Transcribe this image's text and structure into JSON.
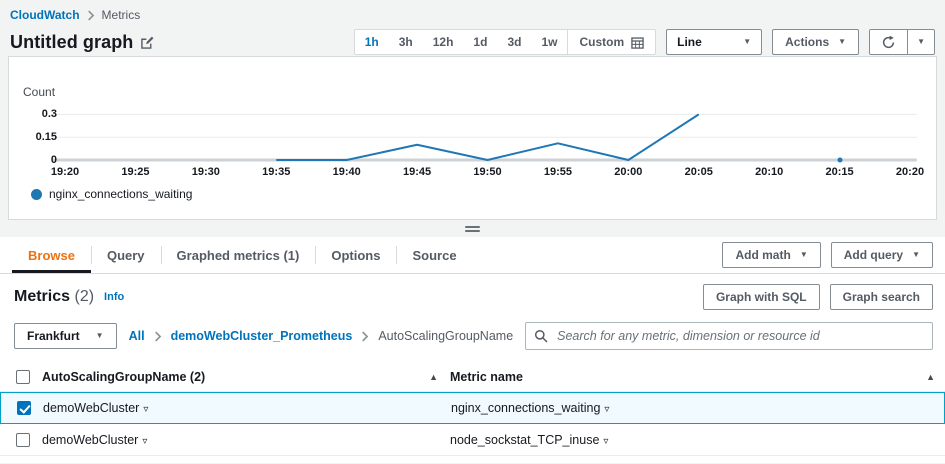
{
  "breadcrumb": {
    "items": [
      {
        "label": "CloudWatch",
        "link": true
      },
      {
        "label": "Metrics",
        "link": false
      }
    ]
  },
  "header": {
    "title": "Untitled graph"
  },
  "toolbar": {
    "time_ranges": [
      {
        "label": "1h",
        "selected": true
      },
      {
        "label": "3h",
        "selected": false
      },
      {
        "label": "12h",
        "selected": false
      },
      {
        "label": "1d",
        "selected": false
      },
      {
        "label": "3d",
        "selected": false
      },
      {
        "label": "1w",
        "selected": false
      }
    ],
    "custom_label": "Custom",
    "chart_type_value": "Line",
    "actions_label": "Actions"
  },
  "chart": {
    "unit_label": "Count",
    "legend": [
      {
        "label": "nginx_connections_waiting",
        "color": "#1f77b4"
      }
    ]
  },
  "chart_data": {
    "type": "line",
    "title": "Untitled graph",
    "ylabel": "Count",
    "x_ticks": [
      "19:20",
      "19:25",
      "19:30",
      "19:35",
      "19:40",
      "19:45",
      "19:50",
      "19:55",
      "20:00",
      "20:05",
      "20:10",
      "20:15",
      "20:20"
    ],
    "y_ticks": [
      0,
      0.15,
      0.3
    ],
    "y_max": 0.375,
    "grid": true,
    "legend_position": "bottom-left",
    "series": [
      {
        "name": "nginx_connections_waiting",
        "color": "#1f77b4",
        "points": [
          {
            "x": "19:35",
            "y": 0
          },
          {
            "x": "19:40",
            "y": 0
          },
          {
            "x": "19:45",
            "y": 0.1
          },
          {
            "x": "19:50",
            "y": 0
          },
          {
            "x": "19:55",
            "y": 0.11
          },
          {
            "x": "20:00",
            "y": 0
          },
          {
            "x": "20:05",
            "y": 0.3
          }
        ],
        "isolated_points": [
          {
            "x": "20:15",
            "y": 0
          }
        ]
      }
    ]
  },
  "panel": {
    "tabs": [
      {
        "label": "Browse",
        "active": true
      },
      {
        "label": "Query",
        "active": false
      },
      {
        "label": "Graphed metrics (1)",
        "active": false
      },
      {
        "label": "Options",
        "active": false
      },
      {
        "label": "Source",
        "active": false
      }
    ],
    "add_math_label": "Add math",
    "add_query_label": "Add query"
  },
  "metrics": {
    "title": "Metrics",
    "count": "(2)",
    "info_label": "Info",
    "graph_with_sql_label": "Graph with SQL",
    "graph_search_label": "Graph search",
    "region_value": "Frankfurt",
    "path": [
      {
        "label": "All",
        "link": true
      },
      {
        "label": "demoWebCluster_Prometheus",
        "link": true
      },
      {
        "label": "AutoScalingGroupName",
        "link": false
      }
    ],
    "search_placeholder": "Search for any metric, dimension or resource id"
  },
  "table": {
    "columns": [
      {
        "label": "AutoScalingGroupName  (2)"
      },
      {
        "label": "Metric name"
      }
    ],
    "rows": [
      {
        "dimension": "demoWebCluster",
        "metric": "nginx_connections_waiting",
        "checked": true,
        "selected": true
      },
      {
        "dimension": "demoWebCluster",
        "metric": "node_sockstat_TCP_inuse",
        "checked": false,
        "selected": false
      }
    ]
  }
}
